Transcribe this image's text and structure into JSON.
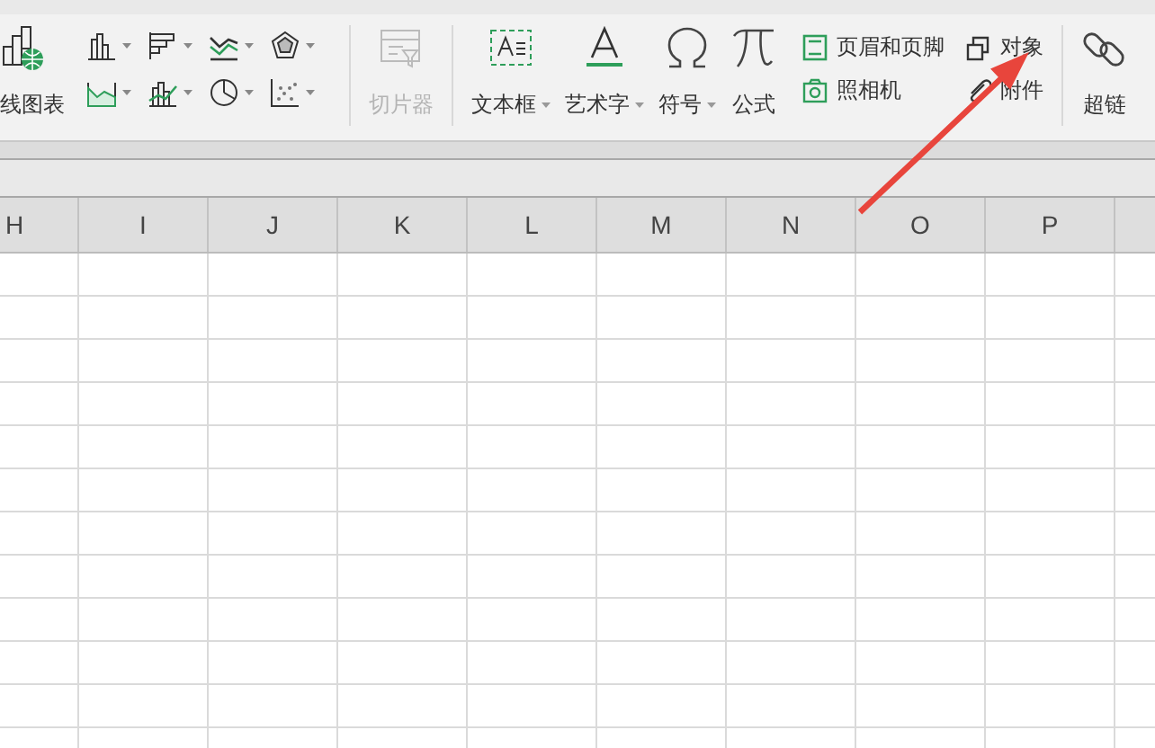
{
  "ribbon": {
    "online_chart": {
      "label": "线图表"
    },
    "large_buttons": [
      {
        "label": "切片器",
        "disabled": true,
        "dropdown": false
      },
      {
        "label": "文本框",
        "disabled": false,
        "dropdown": true
      },
      {
        "label": "艺术字",
        "disabled": false,
        "dropdown": true
      },
      {
        "label": "符号",
        "disabled": false,
        "dropdown": true
      },
      {
        "label": "公式",
        "disabled": false,
        "dropdown": false
      }
    ],
    "small_buttons": [
      {
        "label": "页眉和页脚"
      },
      {
        "label": "照相机"
      },
      {
        "label": "对象"
      },
      {
        "label": "附件"
      }
    ],
    "hyperlink": {
      "label": "超链"
    }
  },
  "sheet": {
    "columns": [
      "H",
      "I",
      "J",
      "K",
      "L",
      "M",
      "N",
      "O",
      "P"
    ]
  }
}
